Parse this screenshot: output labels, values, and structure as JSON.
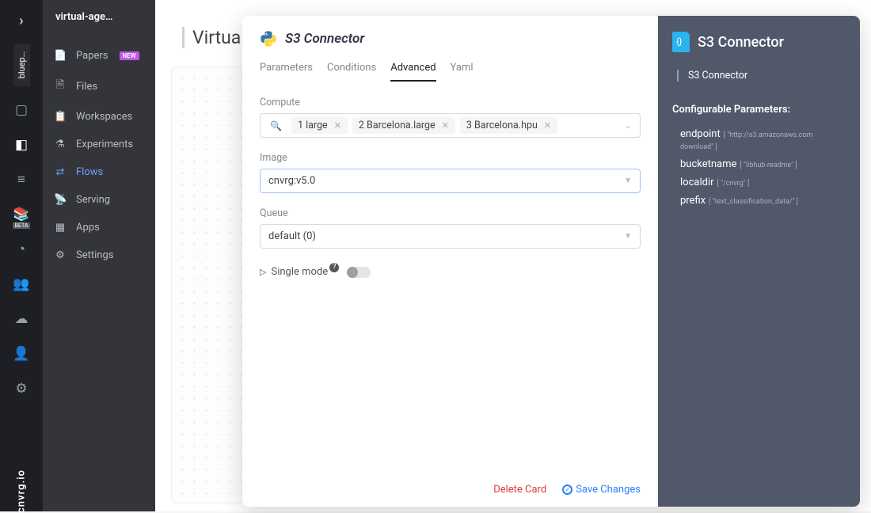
{
  "brand": "cnvrg.io",
  "iconrail": {
    "tab_label": "bluep…",
    "icons": [
      {
        "name": "box-icon"
      },
      {
        "name": "grid-icon",
        "selected": true
      },
      {
        "name": "database-icon"
      },
      {
        "name": "library-icon",
        "beta": "BETA"
      },
      {
        "name": "clock-icon"
      },
      {
        "name": "users-icon"
      },
      {
        "name": "cloud-icon"
      },
      {
        "name": "people-icon"
      },
      {
        "name": "gear-icon"
      }
    ]
  },
  "nav": {
    "title": "virtual-age…",
    "items": [
      {
        "label": "Papers",
        "icon": "📄",
        "badge": "NEW"
      },
      {
        "label": "Files",
        "icon": "🗎"
      },
      {
        "label": "Workspaces",
        "icon": "📋"
      },
      {
        "label": "Experiments",
        "icon": "⚗"
      },
      {
        "label": "Flows",
        "icon": "⇄",
        "active": true
      },
      {
        "label": "Serving",
        "icon": "📡"
      },
      {
        "label": "Apps",
        "icon": "▦"
      },
      {
        "label": "Settings",
        "icon": "⚙"
      }
    ]
  },
  "bg": {
    "title": "Virtual"
  },
  "modal": {
    "title": "S3 Connector",
    "tabs": [
      "Parameters",
      "Conditions",
      "Advanced",
      "Yaml"
    ],
    "active_tab": "Advanced",
    "compute_label": "Compute",
    "compute_chips": [
      "1 large",
      "2 Barcelona.large",
      "3 Barcelona.hpu"
    ],
    "image_label": "Image",
    "image_value": "cnvrg:v5.0",
    "queue_label": "Queue",
    "queue_value": "default (0)",
    "single_mode_label": "Single mode",
    "delete_label": "Delete Card",
    "save_label": "Save Changes"
  },
  "right": {
    "title": "S3 Connector",
    "sub": "S3 Connector",
    "conf_label": "Configurable Parameters:",
    "params": [
      {
        "name": "endpoint",
        "hint": "[ \"http://s3.amazonaws.com download\" ]"
      },
      {
        "name": "bucketname",
        "hint": "[ \"libhub-readme\" ]"
      },
      {
        "name": "localdir",
        "hint": "[ \"/cnvrg\" ]"
      },
      {
        "name": "prefix",
        "hint": "[ \"text_classification_data/\" ]"
      }
    ]
  }
}
